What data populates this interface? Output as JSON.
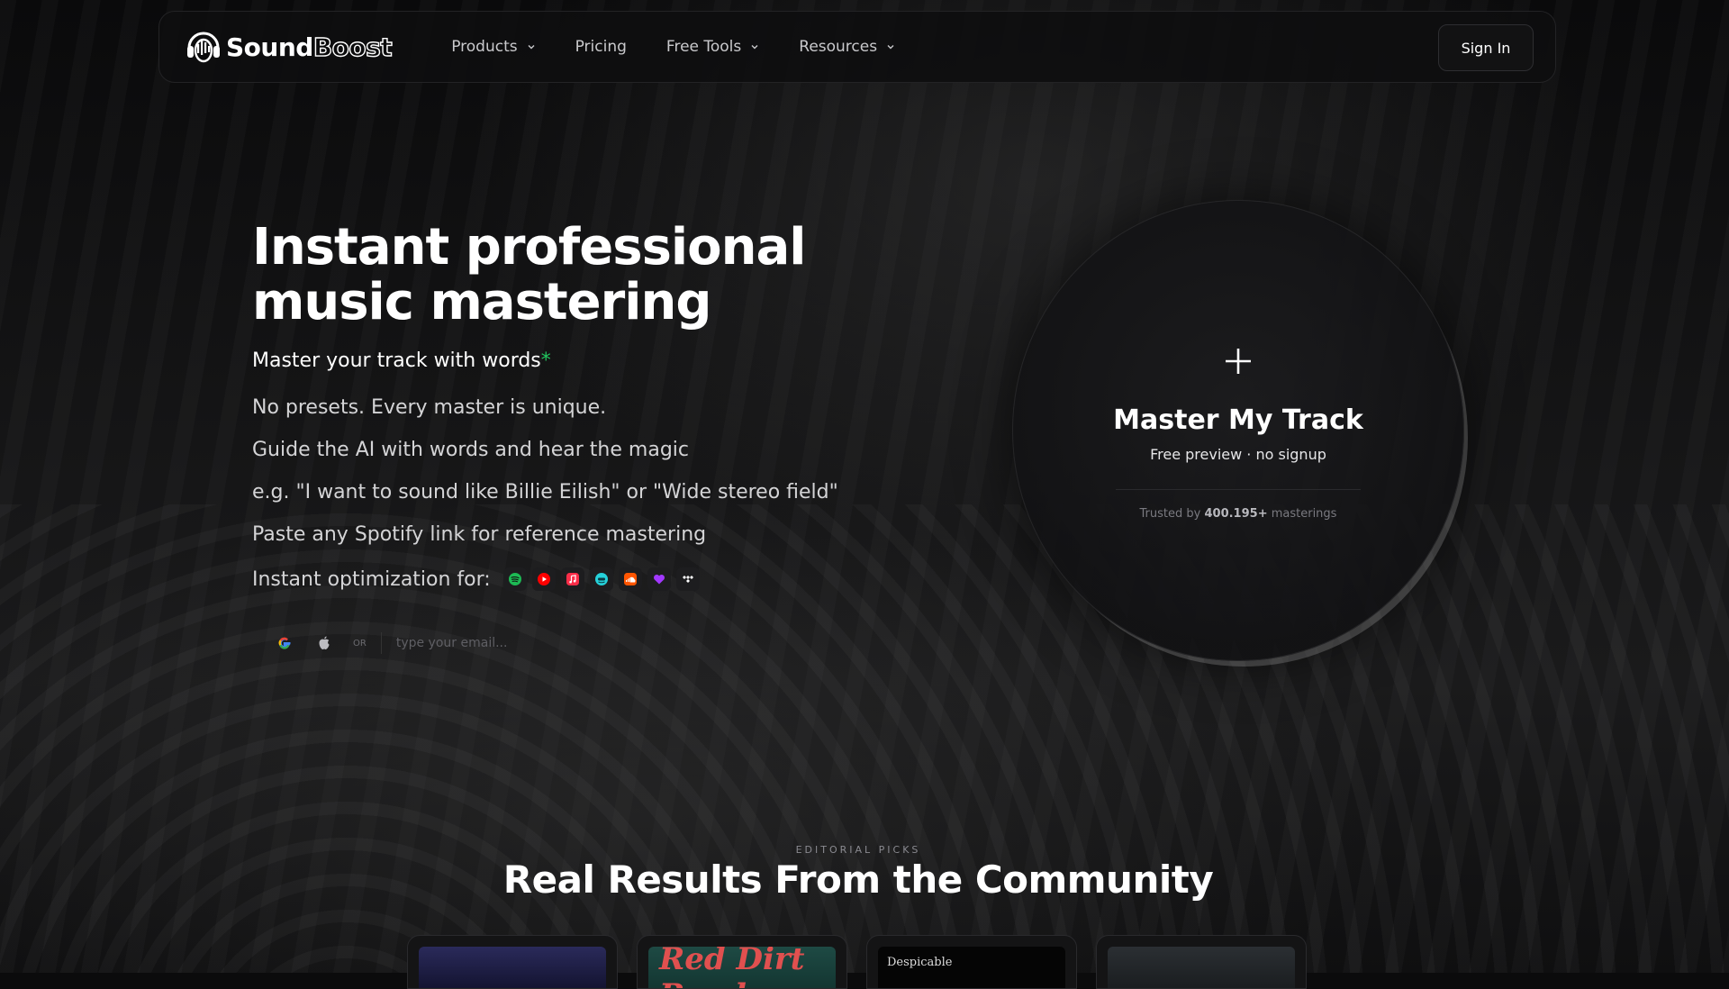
{
  "nav": {
    "brand_a": "Sound",
    "brand_b": "Boost",
    "items": [
      {
        "label": "Products",
        "has_dropdown": true
      },
      {
        "label": "Pricing",
        "has_dropdown": false
      },
      {
        "label": "Free Tools",
        "has_dropdown": true
      },
      {
        "label": "Resources",
        "has_dropdown": true
      }
    ],
    "signin_label": "Sign In"
  },
  "hero": {
    "title_line1": "Instant professional",
    "title_line2": "music mastering",
    "tagline": "Master your track with words",
    "tagline_mark": "*",
    "features": [
      "No presets. Every master is unique.",
      "Guide the AI with words and hear the magic",
      "e.g. \"I want to sound like Billie Eilish\" or \"Wide stereo field\"",
      "Paste any Spotify link for reference mastering"
    ],
    "optimization_label": "Instant optimization for:",
    "platforms": [
      {
        "icon": "spotify-icon",
        "color": "#1DB954"
      },
      {
        "icon": "youtube-icon",
        "color": "#FF0000"
      },
      {
        "icon": "apple-music-icon",
        "color": "#FA2D48"
      },
      {
        "icon": "amazon-music-icon",
        "color": "#25D1DA"
      },
      {
        "icon": "soundcloud-icon",
        "color": "#FF5500"
      },
      {
        "icon": "heart-icon",
        "color": "#A238FF"
      },
      {
        "icon": "tidal-icon",
        "color": "#FFFFFF"
      }
    ],
    "signup": {
      "or_label": "OR",
      "email_placeholder": "type your email..."
    }
  },
  "cta": {
    "title": "Master My Track",
    "subtitle": "Free preview · no signup",
    "trust_prefix": "Trusted by ",
    "trust_count": "400.195+",
    "trust_suffix": " masterings"
  },
  "community": {
    "eyebrow": "EDITORIAL PICKS",
    "title": "Real Results From the Community",
    "card2_text": "Red Dirt Road",
    "card3_text": "Despicable"
  },
  "colors": {
    "accent_green": "#22c55e",
    "background": "#0b0b0c"
  }
}
